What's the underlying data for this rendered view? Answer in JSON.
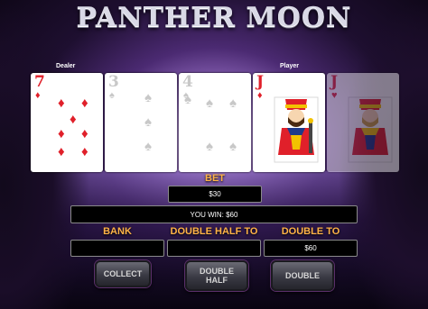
{
  "game": {
    "title": "PANTHER MOON"
  },
  "labels": {
    "dealer": "Dealer",
    "player": "Player"
  },
  "cards": [
    {
      "rank": "7",
      "suit": "diamonds",
      "suit_glyph": "♦",
      "color": "red",
      "faded": false
    },
    {
      "rank": "3",
      "suit": "spades",
      "suit_glyph": "♠",
      "color": "grey",
      "faded": false
    },
    {
      "rank": "4",
      "suit": "spades",
      "suit_glyph": "♠",
      "color": "grey",
      "faded": false
    },
    {
      "rank": "J",
      "suit": "diamonds",
      "suit_glyph": "♦",
      "color": "red",
      "faded": false
    },
    {
      "rank": "J",
      "suit": "hearts",
      "suit_glyph": "♥",
      "color": "red",
      "faded": true
    }
  ],
  "bet": {
    "label": "BET",
    "value": "$30"
  },
  "result": {
    "text": "YOU WIN: $60"
  },
  "bank": {
    "label": "BANK",
    "value": ""
  },
  "double_half": {
    "label": "DOUBLE HALF TO",
    "value": ""
  },
  "double_to": {
    "label": "DOUBLE TO",
    "value": "$60"
  },
  "buttons": {
    "collect": "COLLECT",
    "double_half_line1": "DOUBLE",
    "double_half_line2": "HALF",
    "double": "DOUBLE"
  },
  "colors": {
    "label_orange": "#ffb347",
    "card_red": "#e0202a",
    "card_grey": "#c8c8c8"
  }
}
